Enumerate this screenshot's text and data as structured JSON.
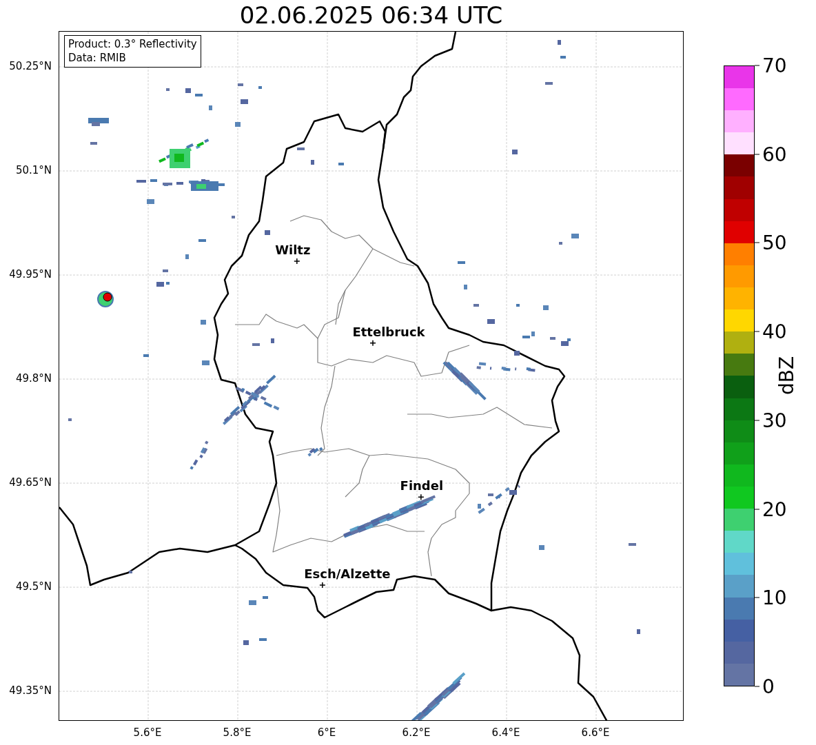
{
  "title": "02.06.2025 06:34 UTC",
  "map": {
    "info": [
      "Product: 0.3° Reflectivity",
      "Data: RMIB"
    ],
    "xticks": [
      "5.6°E",
      "5.8°E",
      "6°E",
      "6.2°E",
      "6.4°E",
      "6.6°E"
    ],
    "yticks": [
      "50.25°N",
      "50.1°N",
      "49.95°N",
      "49.8°N",
      "49.65°N",
      "49.5°N",
      "49.35°N"
    ],
    "places": [
      "Wiltz",
      "Ettelbruck",
      "Findel",
      "Esch/Alzette"
    ]
  },
  "colorbar": {
    "label": "dBZ",
    "ticks": [
      "70",
      "60",
      "50",
      "40",
      "30",
      "20",
      "10",
      "0"
    ]
  }
}
